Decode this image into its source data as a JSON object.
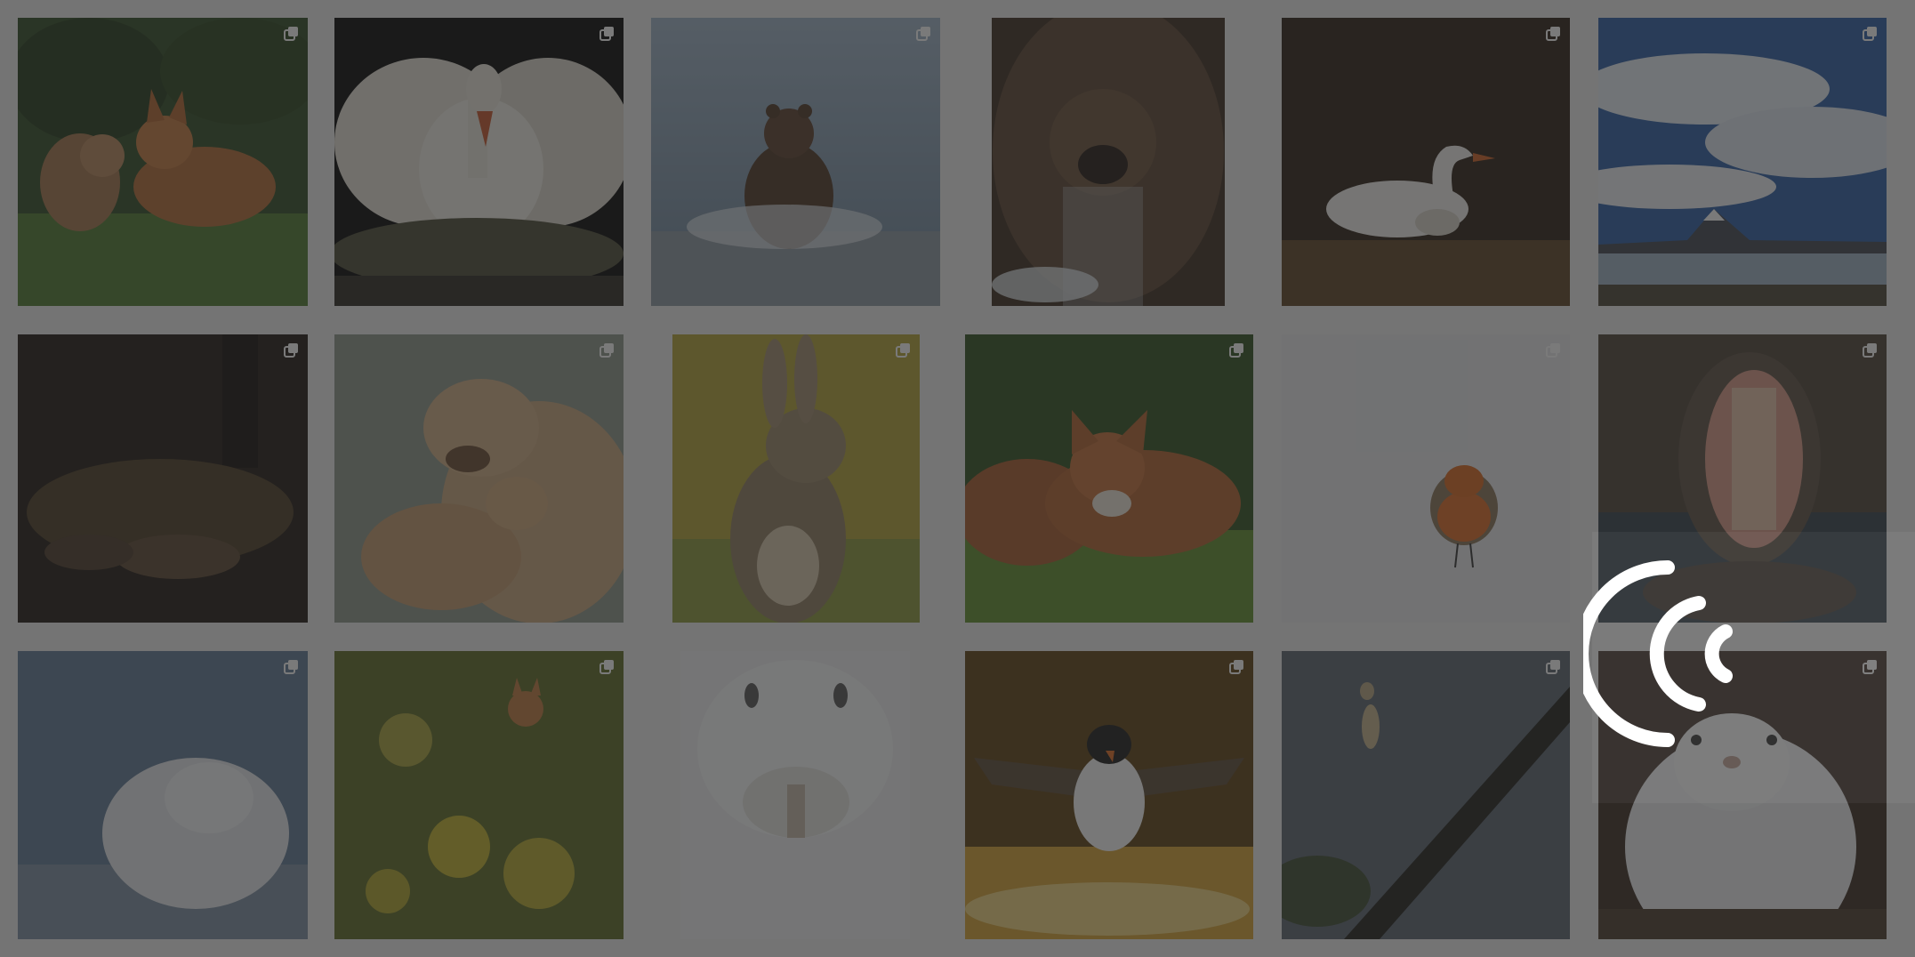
{
  "page": {
    "background": "#f0f0f0",
    "overlay_color": "#282828"
  },
  "gallery": {
    "items": [
      {
        "subject": "fox-cubs",
        "multi_photo": true
      },
      {
        "subject": "swan-nest",
        "multi_photo": true
      },
      {
        "subject": "bear-cub-splash",
        "multi_photo": true
      },
      {
        "subject": "brown-bear",
        "multi_photo": true
      },
      {
        "subject": "swan-cygnet",
        "multi_photo": true
      },
      {
        "subject": "bears-lake-volcano",
        "multi_photo": true
      },
      {
        "subject": "sleeping-cubs-forest",
        "multi_photo": true
      },
      {
        "subject": "lioness-cub",
        "multi_photo": true
      },
      {
        "subject": "rabbit",
        "multi_photo": true
      },
      {
        "subject": "fox-in-grass",
        "multi_photo": true
      },
      {
        "subject": "robin",
        "multi_photo": true
      },
      {
        "subject": "hippo",
        "multi_photo": true
      },
      {
        "subject": "arctic-fox-snow",
        "multi_photo": true
      },
      {
        "subject": "fox-in-flowers",
        "multi_photo": true
      },
      {
        "subject": "mountain-hare",
        "multi_photo": true
      },
      {
        "subject": "puffin",
        "multi_photo": true
      },
      {
        "subject": "squirrel-leap",
        "multi_photo": true
      },
      {
        "subject": "mountain-hare-closeup",
        "multi_photo": true
      }
    ]
  },
  "overlay": {
    "icon": "signal-waves-icon"
  }
}
